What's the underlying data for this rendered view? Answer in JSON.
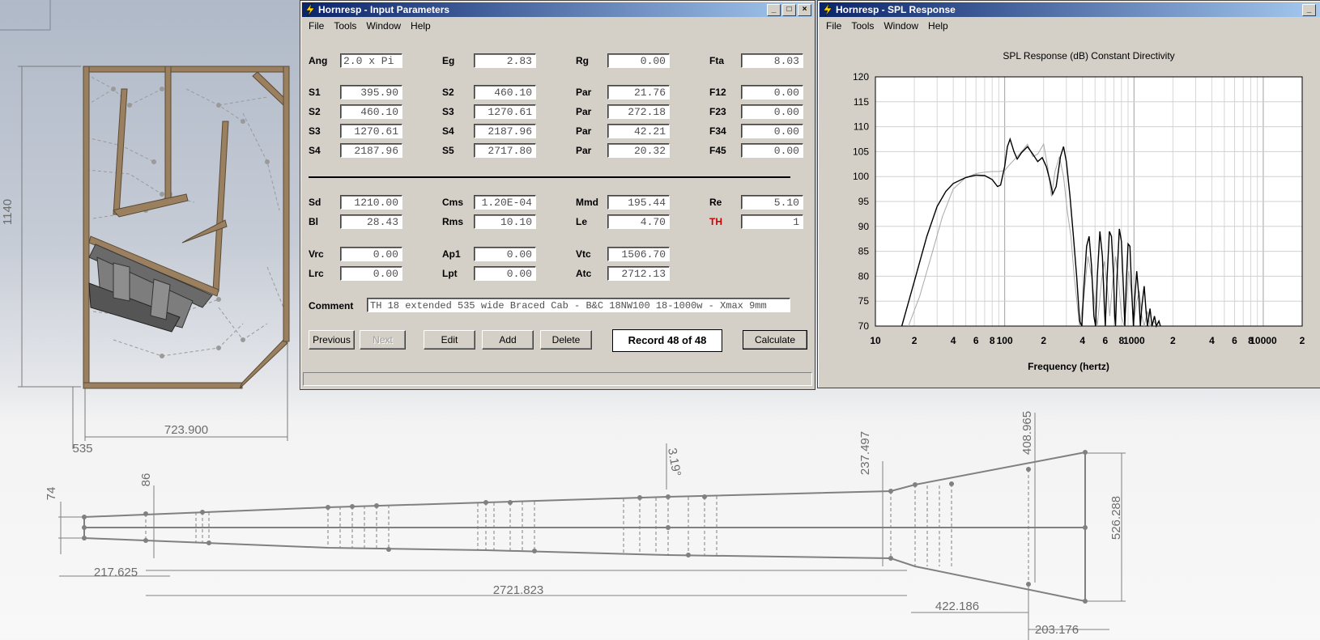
{
  "cad": {
    "dims": {
      "height": "1140",
      "width": "723.900",
      "depth": "535",
      "d74": "74",
      "d86": "86",
      "d217": "217.625",
      "d2721": "2721.823",
      "d3_19": "3.19°",
      "d237": "237.497",
      "d408": "408.965",
      "d526": "526.288",
      "d422": "422.186",
      "d203": "203.176"
    }
  },
  "input_window": {
    "title": "Hornresp - Input Parameters",
    "menu": [
      "File",
      "Tools",
      "Window",
      "Help"
    ],
    "fields": [
      {
        "label": "Ang",
        "value": "2.0 x Pi",
        "align": "left"
      },
      {
        "label": "Eg",
        "value": "2.83"
      },
      {
        "label": "Rg",
        "value": "0.00"
      },
      {
        "label": "Fta",
        "value": "8.03"
      },
      {
        "label": "S1",
        "value": "395.90"
      },
      {
        "label": "S2",
        "value": "460.10"
      },
      {
        "label": "Par",
        "value": "21.76"
      },
      {
        "label": "F12",
        "value": "0.00"
      },
      {
        "label": "S2",
        "value": "460.10"
      },
      {
        "label": "S3",
        "value": "1270.61"
      },
      {
        "label": "Par",
        "value": "272.18"
      },
      {
        "label": "F23",
        "value": "0.00"
      },
      {
        "label": "S3",
        "value": "1270.61"
      },
      {
        "label": "S4",
        "value": "2187.96"
      },
      {
        "label": "Par",
        "value": "42.21"
      },
      {
        "label": "F34",
        "value": "0.00"
      },
      {
        "label": "S4",
        "value": "2187.96"
      },
      {
        "label": "S5",
        "value": "2717.80"
      },
      {
        "label": "Par",
        "value": "20.32"
      },
      {
        "label": "F45",
        "value": "0.00"
      },
      {
        "label": "Sd",
        "value": "1210.00"
      },
      {
        "label": "Cms",
        "value": "1.20E-04"
      },
      {
        "label": "Mmd",
        "value": "195.44"
      },
      {
        "label": "Re",
        "value": "5.10"
      },
      {
        "label": "Bl",
        "value": "28.43"
      },
      {
        "label": "Rms",
        "value": "10.10"
      },
      {
        "label": "Le",
        "value": "4.70"
      },
      {
        "label": "TH",
        "value": "1",
        "accent": "#cc0000"
      },
      {
        "label": "Vrc",
        "value": "0.00"
      },
      {
        "label": "Ap1",
        "value": "0.00"
      },
      {
        "label": "Vtc",
        "value": "1506.70"
      },
      {
        "label": "Lrc",
        "value": "0.00"
      },
      {
        "label": "Lpt",
        "value": "0.00"
      },
      {
        "label": "Atc",
        "value": "2712.13"
      }
    ],
    "comment_label": "Comment",
    "comment": "TH 18  extended 535 wide Braced Cab - B&C 18NW100 18-1000w - Xmax 9mm",
    "buttons": {
      "previous": "Previous",
      "next": "Next",
      "edit": "Edit",
      "add": "Add",
      "delete": "Delete",
      "calculate": "Calculate"
    },
    "record": "Record 48 of 48"
  },
  "spl_window": {
    "title": "Hornresp - SPL Response",
    "menu": [
      "File",
      "Tools",
      "Window",
      "Help"
    ]
  },
  "chart_data": {
    "type": "line",
    "title": "SPL Response (dB)   Constant Directivity",
    "xlabel": "Frequency (hertz)",
    "ylabel": "",
    "x_scale": "log",
    "xlim": [
      10,
      20000
    ],
    "ylim": [
      70,
      120
    ],
    "x_tick_labels": [
      {
        "v": 10,
        "t": "10"
      },
      {
        "v": 20,
        "t": "2"
      },
      {
        "v": 40,
        "t": "4"
      },
      {
        "v": 60,
        "t": "6"
      },
      {
        "v": 80,
        "t": "8"
      },
      {
        "v": 100,
        "t": "100"
      },
      {
        "v": 200,
        "t": "2"
      },
      {
        "v": 400,
        "t": "4"
      },
      {
        "v": 600,
        "t": "6"
      },
      {
        "v": 800,
        "t": "8"
      },
      {
        "v": 1000,
        "t": "1000"
      },
      {
        "v": 2000,
        "t": "2"
      },
      {
        "v": 4000,
        "t": "4"
      },
      {
        "v": 6000,
        "t": "6"
      },
      {
        "v": 8000,
        "t": "8"
      },
      {
        "v": 10000,
        "t": "10000"
      },
      {
        "v": 20000,
        "t": "2"
      }
    ],
    "y_ticks": [
      70,
      75,
      80,
      85,
      90,
      95,
      100,
      105,
      110,
      115,
      120
    ],
    "grid": true,
    "series": [
      {
        "color": "#000000",
        "points": [
          [
            16,
            70
          ],
          [
            20,
            79
          ],
          [
            25,
            88
          ],
          [
            30,
            94
          ],
          [
            35,
            97
          ],
          [
            40,
            98.6
          ],
          [
            50,
            99.8
          ],
          [
            60,
            100.3
          ],
          [
            70,
            100.2
          ],
          [
            80,
            99.4
          ],
          [
            88,
            98
          ],
          [
            93,
            98.3
          ],
          [
            100,
            102
          ],
          [
            105,
            106
          ],
          [
            110,
            107.5
          ],
          [
            118,
            105
          ],
          [
            125,
            103.5
          ],
          [
            135,
            104.8
          ],
          [
            150,
            106
          ],
          [
            165,
            104.5
          ],
          [
            180,
            103
          ],
          [
            195,
            103.8
          ],
          [
            210,
            102
          ],
          [
            225,
            99
          ],
          [
            235,
            96.5
          ],
          [
            250,
            98
          ],
          [
            270,
            104
          ],
          [
            285,
            106
          ],
          [
            300,
            103
          ],
          [
            320,
            96
          ],
          [
            340,
            88
          ],
          [
            360,
            80
          ],
          [
            380,
            71
          ],
          [
            395,
            70
          ],
          [
            410,
            78
          ],
          [
            430,
            86
          ],
          [
            450,
            88
          ],
          [
            470,
            82
          ],
          [
            490,
            72
          ],
          [
            505,
            70
          ],
          [
            520,
            80
          ],
          [
            545,
            89
          ],
          [
            570,
            84
          ],
          [
            590,
            74
          ],
          [
            600,
            70
          ],
          [
            620,
            80
          ],
          [
            645,
            89
          ],
          [
            670,
            88
          ],
          [
            695,
            80
          ],
          [
            710,
            72
          ],
          [
            720,
            70
          ],
          [
            740,
            80
          ],
          [
            770,
            89.5
          ],
          [
            800,
            87
          ],
          [
            830,
            77
          ],
          [
            850,
            70
          ],
          [
            870,
            78
          ],
          [
            900,
            86.5
          ],
          [
            930,
            86
          ],
          [
            965,
            76
          ],
          [
            990,
            70
          ],
          [
            1010,
            75
          ],
          [
            1050,
            81
          ],
          [
            1090,
            76
          ],
          [
            1120,
            70
          ],
          [
            1150,
            74
          ],
          [
            1200,
            78
          ],
          [
            1240,
            73
          ],
          [
            1270,
            70
          ],
          [
            1330,
            73.5
          ],
          [
            1380,
            70
          ],
          [
            1440,
            72
          ],
          [
            1490,
            70
          ],
          [
            1560,
            71
          ],
          [
            1600,
            70
          ]
        ]
      },
      {
        "color": "#a8a8a8",
        "points": [
          [
            18,
            70
          ],
          [
            22,
            76
          ],
          [
            27,
            84
          ],
          [
            33,
            92
          ],
          [
            40,
            97.5
          ],
          [
            50,
            99.8
          ],
          [
            60,
            100.6
          ],
          [
            70,
            100.9
          ],
          [
            80,
            101
          ],
          [
            90,
            101
          ],
          [
            100,
            101.2
          ],
          [
            110,
            102.5
          ],
          [
            125,
            104
          ],
          [
            140,
            105.5
          ],
          [
            150,
            106.5
          ],
          [
            165,
            104
          ],
          [
            180,
            104.5
          ],
          [
            200,
            106.5
          ],
          [
            215,
            102
          ],
          [
            230,
            96
          ],
          [
            245,
            101
          ],
          [
            265,
            104
          ],
          [
            285,
            100
          ],
          [
            305,
            93
          ],
          [
            325,
            88
          ],
          [
            345,
            80
          ],
          [
            365,
            74
          ],
          [
            380,
            70
          ],
          [
            410,
            76
          ],
          [
            440,
            84
          ],
          [
            470,
            80
          ],
          [
            500,
            74
          ],
          [
            520,
            70
          ],
          [
            560,
            79
          ],
          [
            590,
            83
          ],
          [
            620,
            78
          ],
          [
            650,
            72
          ],
          [
            680,
            78
          ],
          [
            720,
            84
          ],
          [
            760,
            79
          ],
          [
            800,
            72
          ],
          [
            840,
            70
          ],
          [
            880,
            76
          ],
          [
            910,
            81
          ],
          [
            950,
            77
          ],
          [
            1000,
            71
          ],
          [
            1050,
            75
          ],
          [
            1100,
            77
          ],
          [
            1150,
            72
          ],
          [
            1200,
            70
          ],
          [
            1270,
            73
          ],
          [
            1330,
            70
          ],
          [
            1420,
            71
          ],
          [
            1500,
            70
          ]
        ]
      }
    ]
  }
}
